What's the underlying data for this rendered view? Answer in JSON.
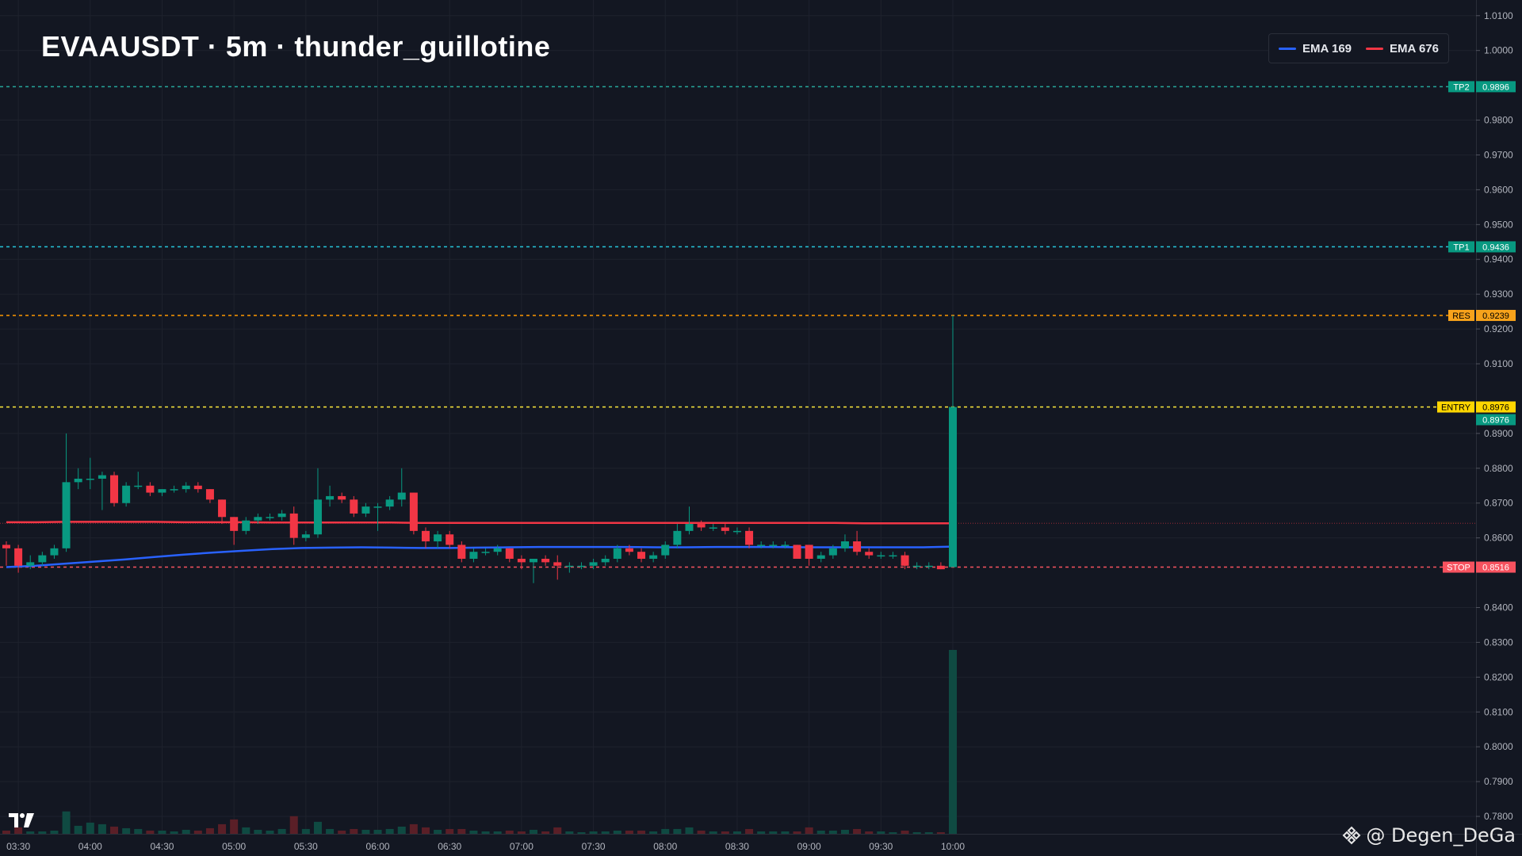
{
  "header": {
    "title": "EVAAUSDT · 5m · thunder_guillotine"
  },
  "legend": {
    "items": [
      {
        "label": "EMA 169",
        "color": "#2962ff"
      },
      {
        "label": "EMA 676",
        "color": "#f23645"
      }
    ]
  },
  "watermark": {
    "text": "@ Degen_DeGa"
  },
  "chart_data": {
    "type": "candlestick",
    "interval": "5m",
    "ylim": [
      0.775,
      1.0145
    ],
    "y_ticks": [
      "1.0100",
      "1.0000",
      "0.9800",
      "0.9700",
      "0.9600",
      "0.9500",
      "0.9400",
      "0.9300",
      "0.9200",
      "0.9100",
      "0.8900",
      "0.8800",
      "0.8700",
      "0.8600",
      "0.8400",
      "0.8300",
      "0.8200",
      "0.8100",
      "0.8000",
      "0.7900",
      "0.7800"
    ],
    "x_labels": [
      "03:30",
      "04:00",
      "04:30",
      "05:00",
      "05:30",
      "06:00",
      "06:30",
      "07:00",
      "07:30",
      "08:00",
      "08:30",
      "09:00",
      "09:30",
      "10:00"
    ],
    "levels": [
      {
        "name": "TP2",
        "value": "0.9896",
        "color": "#26a69a",
        "label_bg": "#089981",
        "text_color": "#ffffff"
      },
      {
        "name": "TP1",
        "value": "0.9436",
        "color": "#26c6da",
        "label_bg": "#089981",
        "text_color": "#ffffff"
      },
      {
        "name": "RES",
        "value": "0.9239",
        "color": "#ff9800",
        "label_bg": "#f7a21b",
        "text_color": "#000000"
      },
      {
        "name": "ENTRY",
        "value": "0.8976",
        "color": "#ffeb3b",
        "label_bg": "#ffd600",
        "text_color": "#000000"
      },
      {
        "name": "STOP",
        "value": "0.8516",
        "color": "#f7525f",
        "label_bg": "#f7525f",
        "text_color": "#ffffff"
      }
    ],
    "last_price": {
      "value": "0.8976",
      "color": "#089981"
    },
    "ema_169": [
      0.8516,
      0.852,
      0.8526,
      0.8532,
      0.8538,
      0.8545,
      0.8552,
      0.8558,
      0.8563,
      0.8568,
      0.8571,
      0.8572,
      0.8573,
      0.8572,
      0.8571,
      0.8571,
      0.8572,
      0.8573,
      0.8574,
      0.8574,
      0.8574,
      0.8574,
      0.8573,
      0.8573,
      0.8574,
      0.8574,
      0.8574,
      0.8573,
      0.8573,
      0.8573,
      0.8573,
      0.8573,
      0.8575
    ],
    "ema_676": [
      0.8645,
      0.8645,
      0.8646,
      0.8646,
      0.8646,
      0.8646,
      0.8645,
      0.8645,
      0.8645,
      0.8644,
      0.8644,
      0.8644,
      0.8644,
      0.8644,
      0.8643,
      0.8643,
      0.8643,
      0.8643,
      0.8643,
      0.8643,
      0.8643,
      0.8643,
      0.8643,
      0.8643,
      0.8643,
      0.8643,
      0.8643,
      0.8643,
      0.8643,
      0.8642,
      0.8642,
      0.8642,
      0.8642
    ],
    "candles": [
      {
        "t": "03:25",
        "o": 0.858,
        "h": 0.859,
        "l": 0.852,
        "c": 0.857,
        "v": 4
      },
      {
        "t": "03:30",
        "o": 0.857,
        "h": 0.858,
        "l": 0.85,
        "c": 0.852,
        "v": 8
      },
      {
        "t": "03:35",
        "o": 0.852,
        "h": 0.855,
        "l": 0.851,
        "c": 0.853,
        "v": 3
      },
      {
        "t": "03:40",
        "o": 0.853,
        "h": 0.856,
        "l": 0.852,
        "c": 0.855,
        "v": 3
      },
      {
        "t": "03:45",
        "o": 0.855,
        "h": 0.858,
        "l": 0.854,
        "c": 0.857,
        "v": 4
      },
      {
        "t": "03:50",
        "o": 0.857,
        "h": 0.89,
        "l": 0.856,
        "c": 0.876,
        "v": 28
      },
      {
        "t": "03:55",
        "o": 0.876,
        "h": 0.88,
        "l": 0.874,
        "c": 0.877,
        "v": 10
      },
      {
        "t": "04:00",
        "o": 0.877,
        "h": 0.883,
        "l": 0.874,
        "c": 0.877,
        "v": 14
      },
      {
        "t": "04:05",
        "o": 0.877,
        "h": 0.879,
        "l": 0.868,
        "c": 0.878,
        "v": 12
      },
      {
        "t": "04:10",
        "o": 0.878,
        "h": 0.879,
        "l": 0.869,
        "c": 0.87,
        "v": 9
      },
      {
        "t": "04:15",
        "o": 0.87,
        "h": 0.876,
        "l": 0.869,
        "c": 0.875,
        "v": 7
      },
      {
        "t": "04:20",
        "o": 0.875,
        "h": 0.879,
        "l": 0.874,
        "c": 0.875,
        "v": 6
      },
      {
        "t": "04:25",
        "o": 0.875,
        "h": 0.876,
        "l": 0.872,
        "c": 0.873,
        "v": 4
      },
      {
        "t": "04:30",
        "o": 0.873,
        "h": 0.874,
        "l": 0.872,
        "c": 0.874,
        "v": 4
      },
      {
        "t": "04:35",
        "o": 0.874,
        "h": 0.875,
        "l": 0.873,
        "c": 0.874,
        "v": 3
      },
      {
        "t": "04:40",
        "o": 0.874,
        "h": 0.876,
        "l": 0.873,
        "c": 0.875,
        "v": 5
      },
      {
        "t": "04:45",
        "o": 0.875,
        "h": 0.876,
        "l": 0.873,
        "c": 0.874,
        "v": 4
      },
      {
        "t": "04:50",
        "o": 0.874,
        "h": 0.874,
        "l": 0.87,
        "c": 0.871,
        "v": 7
      },
      {
        "t": "04:55",
        "o": 0.871,
        "h": 0.871,
        "l": 0.864,
        "c": 0.866,
        "v": 12
      },
      {
        "t": "05:00",
        "o": 0.866,
        "h": 0.866,
        "l": 0.858,
        "c": 0.862,
        "v": 18
      },
      {
        "t": "05:05",
        "o": 0.862,
        "h": 0.866,
        "l": 0.861,
        "c": 0.865,
        "v": 8
      },
      {
        "t": "05:10",
        "o": 0.865,
        "h": 0.867,
        "l": 0.864,
        "c": 0.866,
        "v": 5
      },
      {
        "t": "05:15",
        "o": 0.866,
        "h": 0.867,
        "l": 0.865,
        "c": 0.866,
        "v": 4
      },
      {
        "t": "05:20",
        "o": 0.866,
        "h": 0.868,
        "l": 0.865,
        "c": 0.867,
        "v": 6
      },
      {
        "t": "05:25",
        "o": 0.867,
        "h": 0.869,
        "l": 0.858,
        "c": 0.86,
        "v": 22
      },
      {
        "t": "05:30",
        "o": 0.86,
        "h": 0.862,
        "l": 0.859,
        "c": 0.861,
        "v": 6
      },
      {
        "t": "05:35",
        "o": 0.861,
        "h": 0.88,
        "l": 0.86,
        "c": 0.871,
        "v": 15
      },
      {
        "t": "05:40",
        "o": 0.871,
        "h": 0.875,
        "l": 0.869,
        "c": 0.872,
        "v": 6
      },
      {
        "t": "05:45",
        "o": 0.872,
        "h": 0.873,
        "l": 0.87,
        "c": 0.871,
        "v": 4
      },
      {
        "t": "05:50",
        "o": 0.871,
        "h": 0.872,
        "l": 0.866,
        "c": 0.867,
        "v": 6
      },
      {
        "t": "05:55",
        "o": 0.867,
        "h": 0.87,
        "l": 0.866,
        "c": 0.869,
        "v": 5
      },
      {
        "t": "06:00",
        "o": 0.869,
        "h": 0.87,
        "l": 0.862,
        "c": 0.869,
        "v": 5
      },
      {
        "t": "06:05",
        "o": 0.869,
        "h": 0.872,
        "l": 0.868,
        "c": 0.871,
        "v": 6
      },
      {
        "t": "06:10",
        "o": 0.871,
        "h": 0.88,
        "l": 0.869,
        "c": 0.873,
        "v": 9
      },
      {
        "t": "06:15",
        "o": 0.873,
        "h": 0.873,
        "l": 0.861,
        "c": 0.862,
        "v": 12
      },
      {
        "t": "06:20",
        "o": 0.862,
        "h": 0.863,
        "l": 0.857,
        "c": 0.859,
        "v": 8
      },
      {
        "t": "06:25",
        "o": 0.859,
        "h": 0.862,
        "l": 0.857,
        "c": 0.861,
        "v": 5
      },
      {
        "t": "06:30",
        "o": 0.861,
        "h": 0.862,
        "l": 0.857,
        "c": 0.858,
        "v": 6
      },
      {
        "t": "06:35",
        "o": 0.858,
        "h": 0.859,
        "l": 0.853,
        "c": 0.854,
        "v": 6
      },
      {
        "t": "06:40",
        "o": 0.854,
        "h": 0.857,
        "l": 0.853,
        "c": 0.856,
        "v": 4
      },
      {
        "t": "06:45",
        "o": 0.856,
        "h": 0.857,
        "l": 0.855,
        "c": 0.856,
        "v": 3
      },
      {
        "t": "06:50",
        "o": 0.856,
        "h": 0.858,
        "l": 0.855,
        "c": 0.857,
        "v": 3
      },
      {
        "t": "06:55",
        "o": 0.857,
        "h": 0.857,
        "l": 0.853,
        "c": 0.854,
        "v": 4
      },
      {
        "t": "07:00",
        "o": 0.854,
        "h": 0.855,
        "l": 0.851,
        "c": 0.853,
        "v": 3
      },
      {
        "t": "07:05",
        "o": 0.853,
        "h": 0.854,
        "l": 0.847,
        "c": 0.854,
        "v": 5
      },
      {
        "t": "07:10",
        "o": 0.854,
        "h": 0.855,
        "l": 0.852,
        "c": 0.853,
        "v": 3
      },
      {
        "t": "07:15",
        "o": 0.853,
        "h": 0.855,
        "l": 0.848,
        "c": 0.852,
        "v": 8
      },
      {
        "t": "07:20",
        "o": 0.852,
        "h": 0.853,
        "l": 0.85,
        "c": 0.852,
        "v": 3
      },
      {
        "t": "07:25",
        "o": 0.852,
        "h": 0.853,
        "l": 0.851,
        "c": 0.852,
        "v": 2
      },
      {
        "t": "07:30",
        "o": 0.852,
        "h": 0.854,
        "l": 0.851,
        "c": 0.853,
        "v": 3
      },
      {
        "t": "07:35",
        "o": 0.853,
        "h": 0.855,
        "l": 0.852,
        "c": 0.854,
        "v": 3
      },
      {
        "t": "07:40",
        "o": 0.854,
        "h": 0.858,
        "l": 0.853,
        "c": 0.857,
        "v": 4
      },
      {
        "t": "07:45",
        "o": 0.857,
        "h": 0.858,
        "l": 0.855,
        "c": 0.856,
        "v": 4
      },
      {
        "t": "07:50",
        "o": 0.856,
        "h": 0.857,
        "l": 0.853,
        "c": 0.854,
        "v": 4
      },
      {
        "t": "07:55",
        "o": 0.854,
        "h": 0.856,
        "l": 0.853,
        "c": 0.855,
        "v": 3
      },
      {
        "t": "08:00",
        "o": 0.855,
        "h": 0.859,
        "l": 0.854,
        "c": 0.858,
        "v": 6
      },
      {
        "t": "08:05",
        "o": 0.858,
        "h": 0.864,
        "l": 0.857,
        "c": 0.862,
        "v": 6
      },
      {
        "t": "08:10",
        "o": 0.862,
        "h": 0.869,
        "l": 0.861,
        "c": 0.864,
        "v": 8
      },
      {
        "t": "08:15",
        "o": 0.864,
        "h": 0.865,
        "l": 0.862,
        "c": 0.863,
        "v": 4
      },
      {
        "t": "08:20",
        "o": 0.863,
        "h": 0.864,
        "l": 0.862,
        "c": 0.863,
        "v": 3
      },
      {
        "t": "08:25",
        "o": 0.863,
        "h": 0.864,
        "l": 0.861,
        "c": 0.862,
        "v": 3
      },
      {
        "t": "08:30",
        "o": 0.862,
        "h": 0.863,
        "l": 0.861,
        "c": 0.862,
        "v": 3
      },
      {
        "t": "08:35",
        "o": 0.862,
        "h": 0.863,
        "l": 0.857,
        "c": 0.858,
        "v": 6
      },
      {
        "t": "08:40",
        "o": 0.858,
        "h": 0.859,
        "l": 0.857,
        "c": 0.858,
        "v": 3
      },
      {
        "t": "08:45",
        "o": 0.858,
        "h": 0.859,
        "l": 0.857,
        "c": 0.858,
        "v": 3
      },
      {
        "t": "08:50",
        "o": 0.858,
        "h": 0.859,
        "l": 0.857,
        "c": 0.858,
        "v": 3
      },
      {
        "t": "08:55",
        "o": 0.858,
        "h": 0.858,
        "l": 0.854,
        "c": 0.854,
        "v": 3
      },
      {
        "t": "09:00",
        "o": 0.858,
        "h": 0.858,
        "l": 0.852,
        "c": 0.854,
        "v": 8
      },
      {
        "t": "09:05",
        "o": 0.854,
        "h": 0.856,
        "l": 0.853,
        "c": 0.855,
        "v": 4
      },
      {
        "t": "09:10",
        "o": 0.855,
        "h": 0.858,
        "l": 0.854,
        "c": 0.857,
        "v": 4
      },
      {
        "t": "09:15",
        "o": 0.857,
        "h": 0.861,
        "l": 0.856,
        "c": 0.859,
        "v": 5
      },
      {
        "t": "09:20",
        "o": 0.859,
        "h": 0.862,
        "l": 0.855,
        "c": 0.856,
        "v": 6
      },
      {
        "t": "09:25",
        "o": 0.856,
        "h": 0.857,
        "l": 0.854,
        "c": 0.855,
        "v": 3
      },
      {
        "t": "09:30",
        "o": 0.855,
        "h": 0.856,
        "l": 0.854,
        "c": 0.855,
        "v": 3
      },
      {
        "t": "09:35",
        "o": 0.855,
        "h": 0.856,
        "l": 0.854,
        "c": 0.855,
        "v": 2
      },
      {
        "t": "09:40",
        "o": 0.855,
        "h": 0.856,
        "l": 0.851,
        "c": 0.852,
        "v": 4
      },
      {
        "t": "09:45",
        "o": 0.852,
        "h": 0.853,
        "l": 0.851,
        "c": 0.852,
        "v": 2
      },
      {
        "t": "09:50",
        "o": 0.852,
        "h": 0.853,
        "l": 0.851,
        "c": 0.852,
        "v": 2
      },
      {
        "t": "09:55",
        "o": 0.852,
        "h": 0.853,
        "l": 0.851,
        "c": 0.851,
        "v": 2
      },
      {
        "t": "10:00",
        "o": 0.8516,
        "h": 0.9239,
        "l": 0.8516,
        "c": 0.8976,
        "v": 230
      }
    ]
  }
}
